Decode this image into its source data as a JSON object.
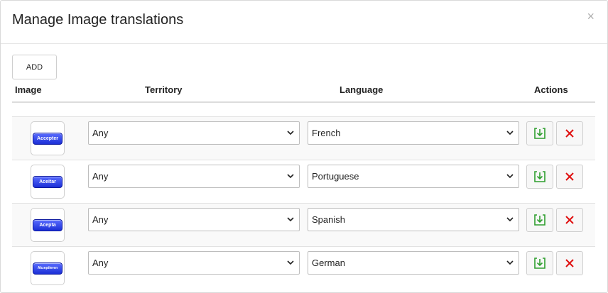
{
  "dialog": {
    "title": "Manage Image translations",
    "close_label": "×"
  },
  "toolbar": {
    "add_label": "ADD"
  },
  "table": {
    "headers": {
      "image": "Image",
      "territory": "Territory",
      "language": "Language",
      "actions": "Actions"
    },
    "rows": [
      {
        "image_text": "Accepter",
        "territory": "Any",
        "language": "French"
      },
      {
        "image_text": "Aceitar",
        "territory": "Any",
        "language": "Portuguese"
      },
      {
        "image_text": "Acepta",
        "territory": "Any",
        "language": "Spanish"
      },
      {
        "image_text": "Akzeptieren",
        "territory": "Any",
        "language": "German"
      }
    ]
  },
  "colors": {
    "save_icon": "#2e9e2e",
    "delete_icon": "#e01010",
    "image_button": "#1b2fd6"
  },
  "icons": {
    "save": "save-download-icon",
    "delete": "close-x-icon",
    "select": "chevron-down-icon"
  }
}
